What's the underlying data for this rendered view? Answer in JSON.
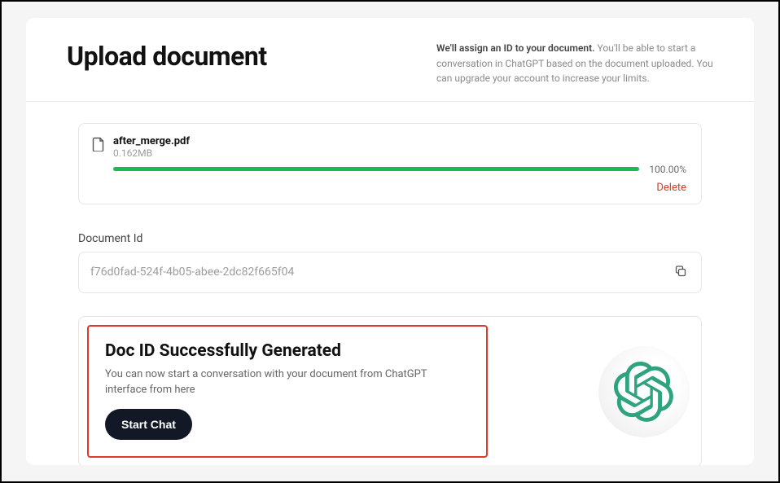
{
  "header": {
    "title": "Upload document",
    "desc_bold": "We'll assign an ID to your document.",
    "desc_rest": " You'll be able to start a conversation in ChatGPT based on the document uploaded. You can upgrade your account to increase your limits."
  },
  "file": {
    "name": "after_merge.pdf",
    "size": "0.162MB",
    "progress_pct": "100.00%",
    "delete_label": "Delete"
  },
  "doc_id": {
    "label": "Document Id",
    "value": "f76d0fad-524f-4b05-abee-2dc82f665f04"
  },
  "success": {
    "title": "Doc ID Successfully Generated",
    "desc": "You can now start a conversation with your document from ChatGPT interface from here",
    "button": "Start Chat"
  }
}
